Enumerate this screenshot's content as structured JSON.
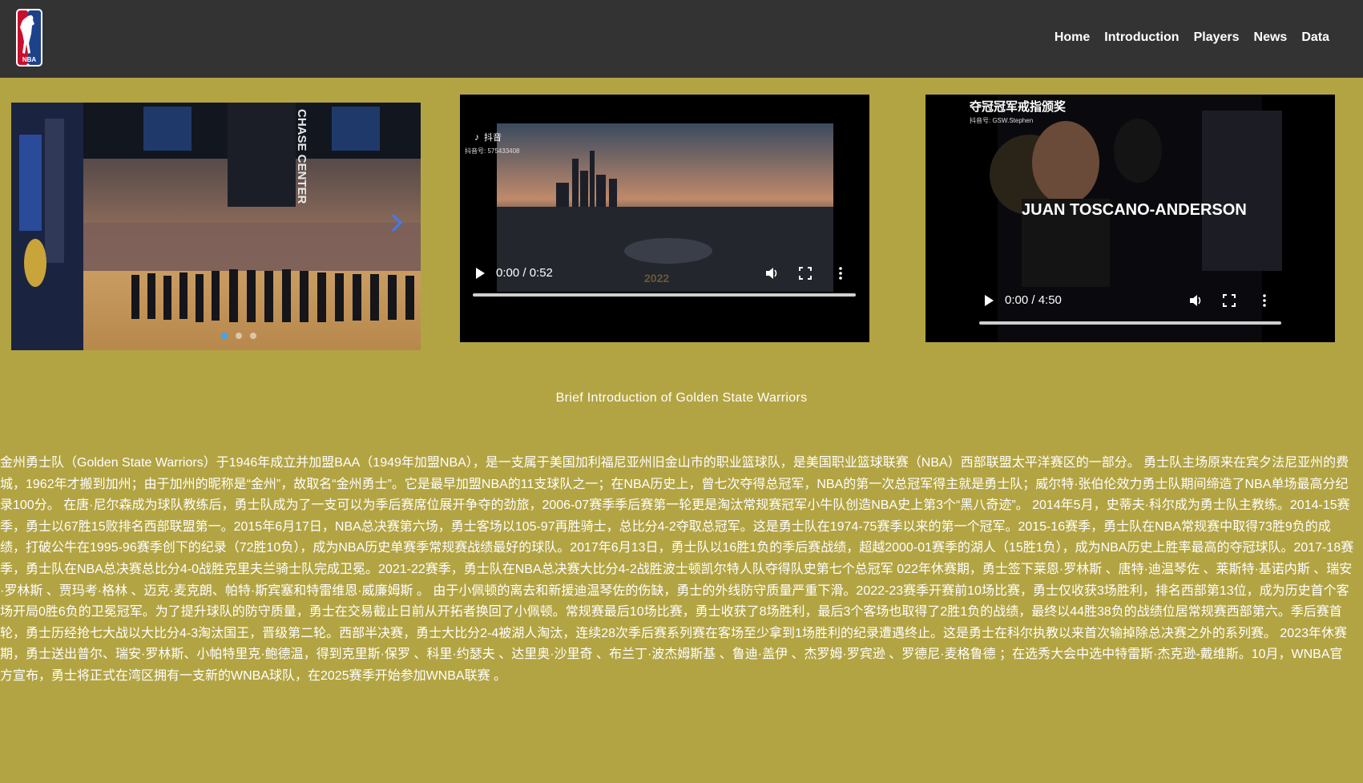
{
  "nav": {
    "items": [
      "Home",
      "Introduction",
      "Players",
      "News",
      "Data"
    ]
  },
  "logo": {
    "text": "NBA",
    "colors": {
      "red": "#c8102e",
      "blue": "#1d428a"
    }
  },
  "videos": [
    {
      "overlay_brand": "抖音",
      "overlay_id": "抖音号: 575433408",
      "year_text": "2022",
      "time": "0:00 / 0:52"
    },
    {
      "overlay_title": "夺冠冠军戒指颁奖",
      "overlay_id": "抖音号: GSW.Stephen",
      "player_text": "JUAN TOSCANO-ANDERSON",
      "time": "0:00 / 4:50"
    }
  ],
  "carousel": {
    "arena_sign": "CHASE CENTER",
    "active_dot": 0,
    "dot_count": 3
  },
  "intro": {
    "title": "Brief Introduction of Golden State Warriors",
    "body": "金州勇士队（Golden State Warriors）于1946年成立并加盟BAA（1949年加盟NBA），是一支属于美国加利福尼亚州旧金山市的职业篮球队，是美国职业篮球联赛（NBA）西部联盟太平洋赛区的一部分。 勇士队主场原来在宾夕法尼亚州的费城，1962年才搬到加州；由于加州的昵称是“金州”，故取名“金州勇士”。它是最早加盟NBA的11支球队之一；在NBA历史上，曾七次夺得总冠军，NBA的第一次总冠军得主就是勇士队；威尔特·张伯伦效力勇士队期间缔造了NBA单场最高分纪录100分。 在唐·尼尔森成为球队教练后，勇士队成为了一支可以为季后赛席位展开争夺的劲旅，2006-07赛季季后赛第一轮更是淘汰常规赛冠军小牛队创造NBA史上第3个“黑八奇迹”。 2014年5月，史蒂夫·科尔成为勇士队主教练。2014-15赛季，勇士以67胜15败排名西部联盟第一。2015年6月17日，NBA总决赛第六场，勇士客场以105-97再胜骑士，总比分4-2夺取总冠军。这是勇士队在1974-75赛季以来的第一个冠军。2015-16赛季，勇士队在NBA常规赛中取得73胜9负的成绩，打破公牛在1995-96赛季创下的纪录（72胜10负），成为NBA历史单赛季常规赛战绩最好的球队。2017年6月13日，勇士队以16胜1负的季后赛战绩，超越2000-01赛季的湖人（15胜1负），成为NBA历史上胜率最高的夺冠球队。2017-18赛季，勇士队在NBA总决赛总比分4-0战胜克里夫兰骑士队完成卫冕。2021-22赛季，勇士队在NBA总决赛大比分4-2战胜波士顿凯尔特人队夺得队史第七个总冠军 022年休赛期，勇士签下莱恩·罗林斯 、唐特·迪温琴佐 、莱斯特·基诺内斯 、瑞安·罗林斯 、贾玛考·格林 、迈克·麦克朗、帕特·斯宾塞和特雷维恩·威廉姆斯 。 由于小佩顿的离去和新援迪温琴佐的伤缺，勇士的外线防守质量严重下滑。2022-23赛季开赛前10场比赛，勇士仅收获3场胜利，排名西部第13位，成为历史首个客场开局0胜6负的卫冕冠军。为了提升球队的防守质量，勇士在交易截止日前从开拓者换回了小佩顿。常规赛最后10场比赛，勇士收获了8场胜利，最后3个客场也取得了2胜1负的战绩，最终以44胜38负的战绩位居常规赛西部第六。季后赛首轮，勇士历经抢七大战以大比分4-3淘汰国王，晋级第二轮。西部半决赛，勇士大比分2-4被湖人淘汰，连续28次季后赛系列赛在客场至少拿到1场胜利的纪录遭遇终止。这是勇士在科尔执教以来首次输掉除总决赛之外的系列赛。 2023年休赛期，勇士送出普尔、瑞安·罗林斯、小帕特里克·鲍德温，得到克里斯·保罗 、科里·约瑟夫 、达里奥·沙里奇 、布兰丁·波杰姆斯基 、鲁迪·盖伊 、杰罗姆·罗宾逊 、罗德尼·麦格鲁德 ；在选秀大会中选中特雷斯·杰克逊-戴维斯。10月，WNBA官方宣布，勇士将正式在湾区拥有一支新的WNBA球队，在2025赛季开始参加WNBA联赛 。"
  }
}
